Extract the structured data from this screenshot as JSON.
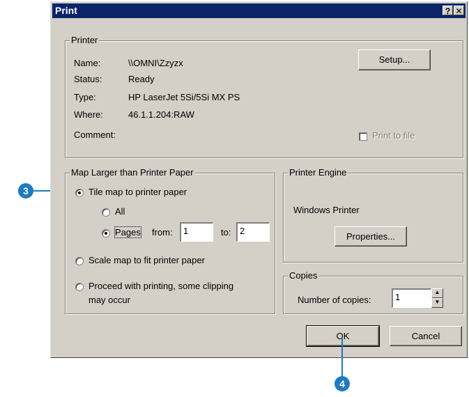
{
  "dialog": {
    "title": "Print",
    "help_label": "?",
    "close_label": "✕"
  },
  "printer": {
    "group_label": "Printer",
    "name_label": "Name:",
    "name_value": "\\\\OMNI\\Zzyzx",
    "status_label": "Status:",
    "status_value": "Ready",
    "type_label": "Type:",
    "type_value": "HP LaserJet 5Si/5Si MX PS",
    "where_label": "Where:",
    "where_value": "46.1.1.204:RAW",
    "comment_label": "Comment:",
    "setup_label": "Setup...",
    "print_to_file_label": "Print to file"
  },
  "map_larger": {
    "group_label": "Map Larger than Printer Paper",
    "tile_label": "Tile map to printer paper",
    "all_label": "All",
    "pages_label": "Pages",
    "from_label": "from:",
    "from_value": "1",
    "to_label": "to:",
    "to_value": "2",
    "scale_label": "Scale map to fit printer paper",
    "proceed_label_line1": "Proceed with printing, some clipping",
    "proceed_label_line2": "may occur"
  },
  "engine": {
    "group_label": "Printer Engine",
    "engine_value": "Windows Printer",
    "properties_label": "Properties..."
  },
  "copies": {
    "group_label": "Copies",
    "number_label": "Number of copies:",
    "number_value": "1"
  },
  "buttons": {
    "ok_label": "OK",
    "cancel_label": "Cancel"
  },
  "callouts": {
    "step3": "3",
    "step4": "4"
  },
  "colors": {
    "title_bar": "#0a246a",
    "callout": "#1f7bc0",
    "dialog_face": "#d4d0c8"
  }
}
